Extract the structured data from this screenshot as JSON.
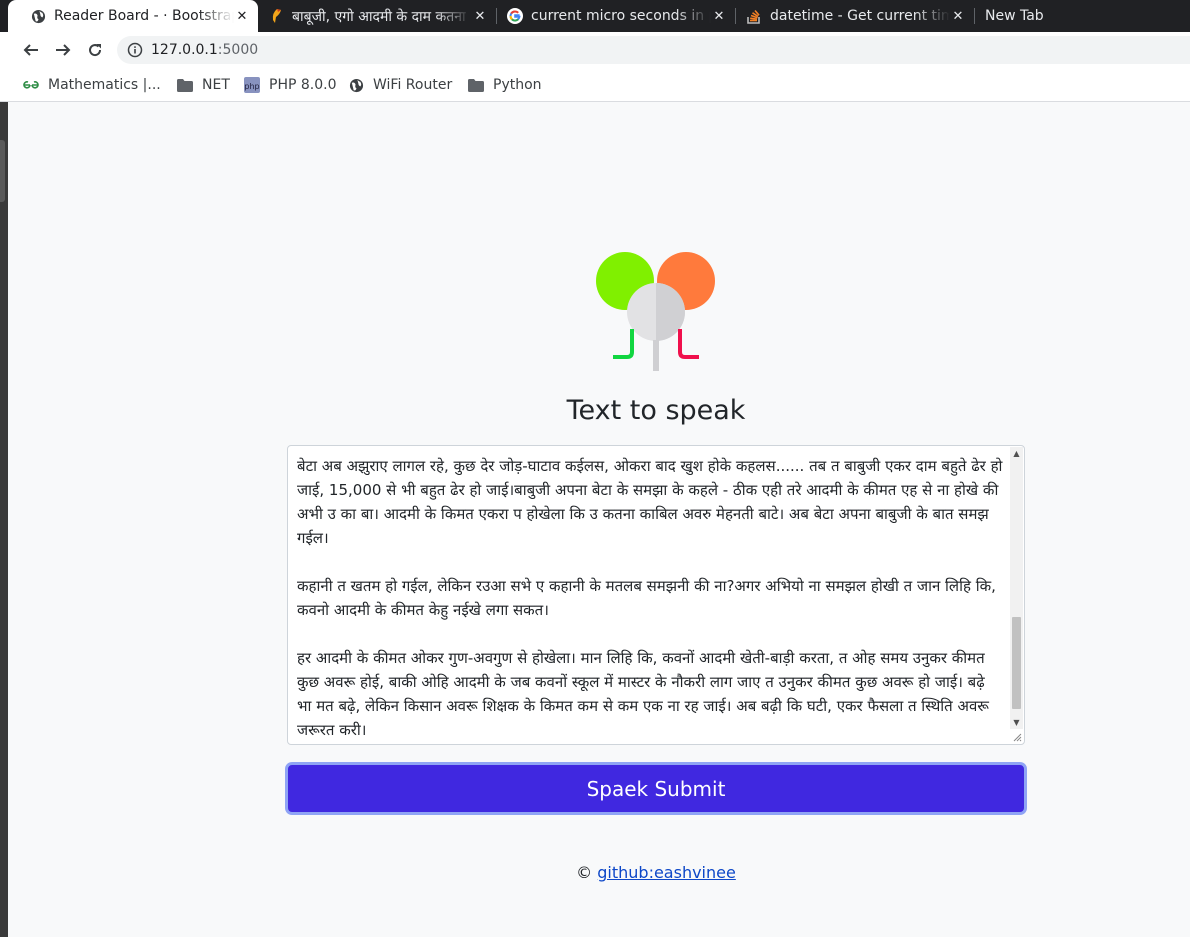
{
  "browser": {
    "tabs": [
      {
        "title": "Reader Board - · Bootstrap",
        "close": "✕",
        "icon": "globe-icon",
        "active": true
      },
      {
        "title": "बाबूजी, एगो आदमी के दाम कतना",
        "close": "✕",
        "icon": "bird-icon",
        "active": false
      },
      {
        "title": "current micro seconds in python",
        "close": "✕",
        "icon": "google-icon",
        "active": false
      },
      {
        "title": "datetime - Get current time",
        "close": "✕",
        "icon": "stackoverflow-icon",
        "active": false
      },
      {
        "title": "New Tab",
        "close": "",
        "icon": "",
        "active": false
      }
    ],
    "url_host": "127.0.0.1",
    "url_port": ":5000",
    "bookmarks": [
      {
        "label": "Mathematics |...",
        "icon": "geeksforgeeks-icon"
      },
      {
        "label": "NET",
        "icon": "folder-icon"
      },
      {
        "label": "PHP 8.0.0",
        "icon": "php-icon"
      },
      {
        "label": "WiFi Router",
        "icon": "globe-icon"
      },
      {
        "label": "Python",
        "icon": "folder-icon"
      }
    ]
  },
  "page": {
    "heading": "Text to speak",
    "textarea_text": "बेटा अब अझुराए लागल रहे, कुछ देर जोड़-घाटाव कईलस, ओकरा बाद खुश होके कहलस...... तब त बाबुजी एकर दाम बहुते ढेर हो जाई, 15,000 से भी बहुत ढेर हो जाई।बाबुजी अपना बेटा के समझा के कहले - ठीक एही तरे आदमी के कीमत एह से ना होखे की अभी उ का बा। आदमी के किमत एकरा प होखेला कि उ कतना काबिल अवरु मेहनती बाटे। अब बेटा अपना बाबुजी के बात समझ गईल।\n\nकहानी त खतम हो गईल, लेकिन रउआ सभे ए कहानी के मतलब समझनी की ना?अगर अभियो ना समझल होखी त जान लिहि कि, कवनो आदमी के कीमत केहु नईखे लगा सकत।\n\nहर आदमी के कीमत ओकर गुण-अवगुण से होखेला। मान लिहि कि, कवनों आदमी खेती-बाड़ी करता, त ओह समय उनुकर कीमत कुछ अवरू होई, बाकी ओहि आदमी के जब कवनों स्कूल में मास्टर के नौकरी लाग जाए त उनुकर कीमत कुछ अवरू हो जाई। बढ़े भा मत बढ़े, लेकिन किसान अवरू शिक्षक के किमत कम से कम एक ना रह जाई। अब बढ़ी कि घटी, एकर फैसला त स्थिति अवरू जरूरत करी।",
    "submit_label": "Spaek Submit",
    "footer_prefix": "© ",
    "footer_link": "github:eashvinee"
  }
}
